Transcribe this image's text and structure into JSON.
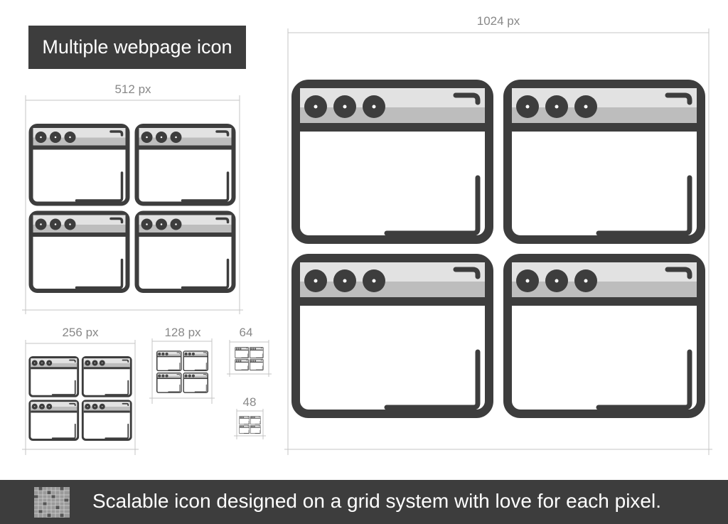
{
  "title": "Multiple webpage icon",
  "sizes": {
    "s1024": "1024 px",
    "s512": "512 px",
    "s256": "256 px",
    "s128": "128 px",
    "s64": "64",
    "s48": "48"
  },
  "footer": {
    "text": "Scalable icon designed on a grid system with love for each pixel.",
    "icon": "pixel-grid-icon"
  },
  "colors": {
    "dark": "#3d3d3d",
    "titlebar_light": "#e2e2e2",
    "titlebar_shade": "#bdbdbd",
    "guide": "#bbbbbb"
  },
  "icon": "multiple-webpage-icon"
}
